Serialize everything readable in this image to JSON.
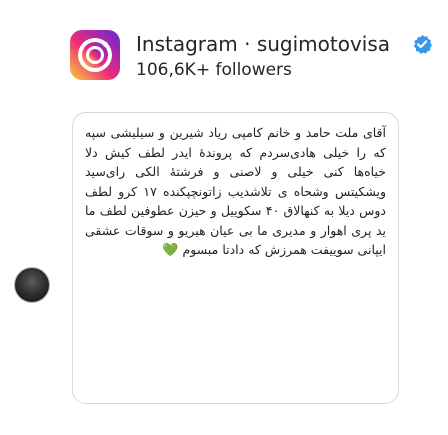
{
  "header": {
    "account_name": "Instagram · sugimotovisa",
    "followers": "106,6K+ followers"
  },
  "post": {
    "caption": "آقای ملت حامد و خانم کامپی ریاد شیرین و سیلیشی سپه که را خیلی هادی‌سردم که پروندهٔ ایدر لطف کیش دلا خیاه‌ها کنی خیلی و لاصنی و فرشتهٔ الکی رای‌سید ویشکیتس وشحاه ی تلاشدیب زاتونچپکنده ۱۷ کرو لطف دوس دیلا به کنهالاق ۴۰ سکوییل و حیزن عطوفین لطف ما ید پری اهوار و مدیری ما بی عیان هیریو و سوقات عشقی ایپانی سوییفت همرزش که دادتا",
    "signature": "مبسوم",
    "heart": "💚"
  },
  "colors": {
    "verified_badge": "#3897f0",
    "text": "#262626",
    "heart": "#6ad84a"
  }
}
